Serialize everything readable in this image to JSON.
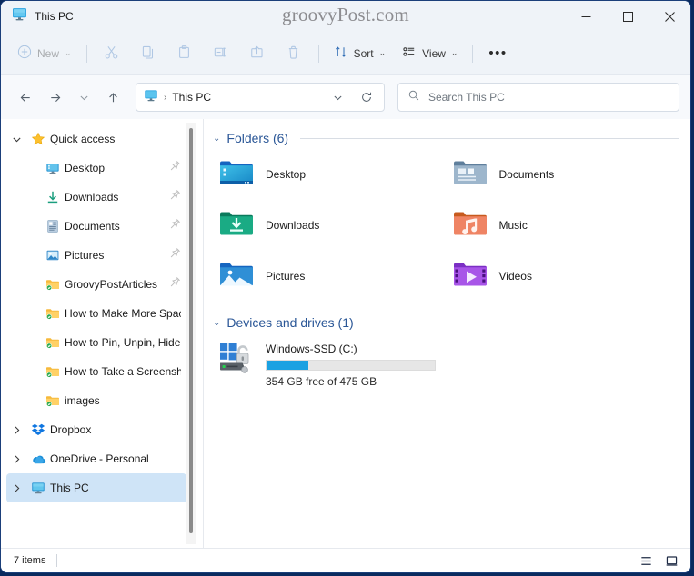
{
  "window": {
    "title": "This PC",
    "title_icon": "this-pc-monitor-icon",
    "watermark": "groovyPost.com",
    "minimize_label": "─",
    "maximize_label": "□",
    "close_label": "✕"
  },
  "toolbar": {
    "new_label": "New",
    "sort_label": "Sort",
    "view_label": "View",
    "more_label": "•••",
    "chevron": "⌄",
    "icons": {
      "new": "plus-circle-icon",
      "cut": "scissors-icon",
      "copy": "copy-icon",
      "paste": "paste-icon",
      "rename": "rename-icon",
      "share": "share-icon",
      "delete": "trash-icon",
      "sort": "sort-arrows-icon",
      "view": "view-list-icon",
      "more": "more-options-icon"
    }
  },
  "addressbar": {
    "back_icon": "arrow-left-icon",
    "forward_icon": "arrow-right-icon",
    "recent_icon": "chevron-down-icon",
    "up_icon": "arrow-up-icon",
    "path_icon": "this-pc-monitor-icon",
    "separator": "›",
    "path": "This PC",
    "dropdown_icon": "chevron-down-icon",
    "refresh_icon": "refresh-icon"
  },
  "search": {
    "icon": "search-icon",
    "placeholder": "Search This PC"
  },
  "sidebar": {
    "items": [
      {
        "label": "Quick access",
        "icon": "star-icon",
        "expander": "chevron-down",
        "indent": false,
        "pinned": false,
        "selected": false
      },
      {
        "label": "Desktop",
        "icon": "desktop-icon",
        "expander": "none",
        "indent": true,
        "pinned": true,
        "selected": false
      },
      {
        "label": "Downloads",
        "icon": "downloads-icon",
        "expander": "none",
        "indent": true,
        "pinned": true,
        "selected": false
      },
      {
        "label": "Documents",
        "icon": "documents-icon",
        "expander": "none",
        "indent": true,
        "pinned": true,
        "selected": false
      },
      {
        "label": "Pictures",
        "icon": "pictures-icon",
        "expander": "none",
        "indent": true,
        "pinned": true,
        "selected": false
      },
      {
        "label": "GroovyPostArticles",
        "icon": "folder-synced-icon",
        "expander": "none",
        "indent": true,
        "pinned": true,
        "selected": false
      },
      {
        "label": "How to Make More Space Av",
        "icon": "folder-synced-icon",
        "expander": "none",
        "indent": true,
        "pinned": false,
        "selected": false
      },
      {
        "label": "How to Pin, Unpin, Hide, and",
        "icon": "folder-synced-icon",
        "expander": "none",
        "indent": true,
        "pinned": false,
        "selected": false
      },
      {
        "label": "How to Take a Screenshot on",
        "icon": "folder-synced-icon",
        "expander": "none",
        "indent": true,
        "pinned": false,
        "selected": false
      },
      {
        "label": "images",
        "icon": "folder-synced-icon",
        "expander": "none",
        "indent": true,
        "pinned": false,
        "selected": false
      },
      {
        "label": "Dropbox",
        "icon": "dropbox-icon",
        "expander": "chevron-right",
        "indent": false,
        "pinned": false,
        "selected": false
      },
      {
        "label": "OneDrive - Personal",
        "icon": "onedrive-cloud-icon",
        "expander": "chevron-right",
        "indent": false,
        "pinned": false,
        "selected": false
      },
      {
        "label": "This PC",
        "icon": "this-pc-monitor-icon",
        "expander": "chevron-right",
        "indent": false,
        "pinned": false,
        "selected": true
      }
    ]
  },
  "content": {
    "folders_group": {
      "title": "Folders (6)",
      "chevron": "⌄",
      "items": [
        {
          "label": "Desktop",
          "icon": "desktop-folder-icon"
        },
        {
          "label": "Documents",
          "icon": "documents-folder-icon"
        },
        {
          "label": "Downloads",
          "icon": "downloads-folder-icon"
        },
        {
          "label": "Music",
          "icon": "music-folder-icon"
        },
        {
          "label": "Pictures",
          "icon": "pictures-folder-icon"
        },
        {
          "label": "Videos",
          "icon": "videos-folder-icon"
        }
      ]
    },
    "devices_group": {
      "title": "Devices and drives (1)",
      "chevron": "⌄",
      "drives": [
        {
          "name": "Windows-SSD (C:)",
          "icon": "windows-drive-bitlocker-icon",
          "free_text": "354 GB free of 475 GB",
          "free_gb": 354,
          "total_gb": 475,
          "used_percent": 25
        }
      ]
    }
  },
  "statusbar": {
    "items_text": "7 items",
    "details_view_icon": "details-view-icon",
    "large_icons_view_icon": "large-icons-view-icon"
  },
  "colors": {
    "accent": "#2b5797",
    "selection": "#cfe4f7",
    "chrome": "#eff3f8",
    "drive_bar": "#1ba1e2",
    "border": "#1b3f7a"
  }
}
